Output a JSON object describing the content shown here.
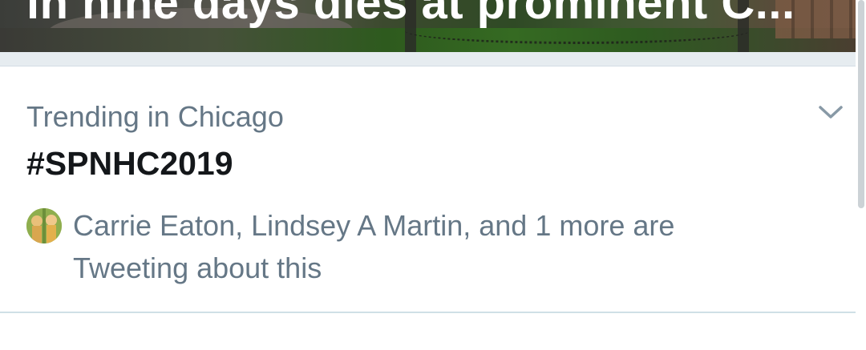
{
  "top_card": {
    "headline_fragment": "in nine days dies at prominent C..."
  },
  "trend": {
    "context": "Trending in Chicago",
    "name": "#SPNHC2019",
    "social_proof": "Carrie Eaton, Lindsey A Martin, and 1 more are Tweeting about this",
    "caret_icon": "chevron-down-icon"
  },
  "colors": {
    "secondary_text": "#657786",
    "primary_text": "#14171a",
    "separator": "#e6ecf0"
  }
}
